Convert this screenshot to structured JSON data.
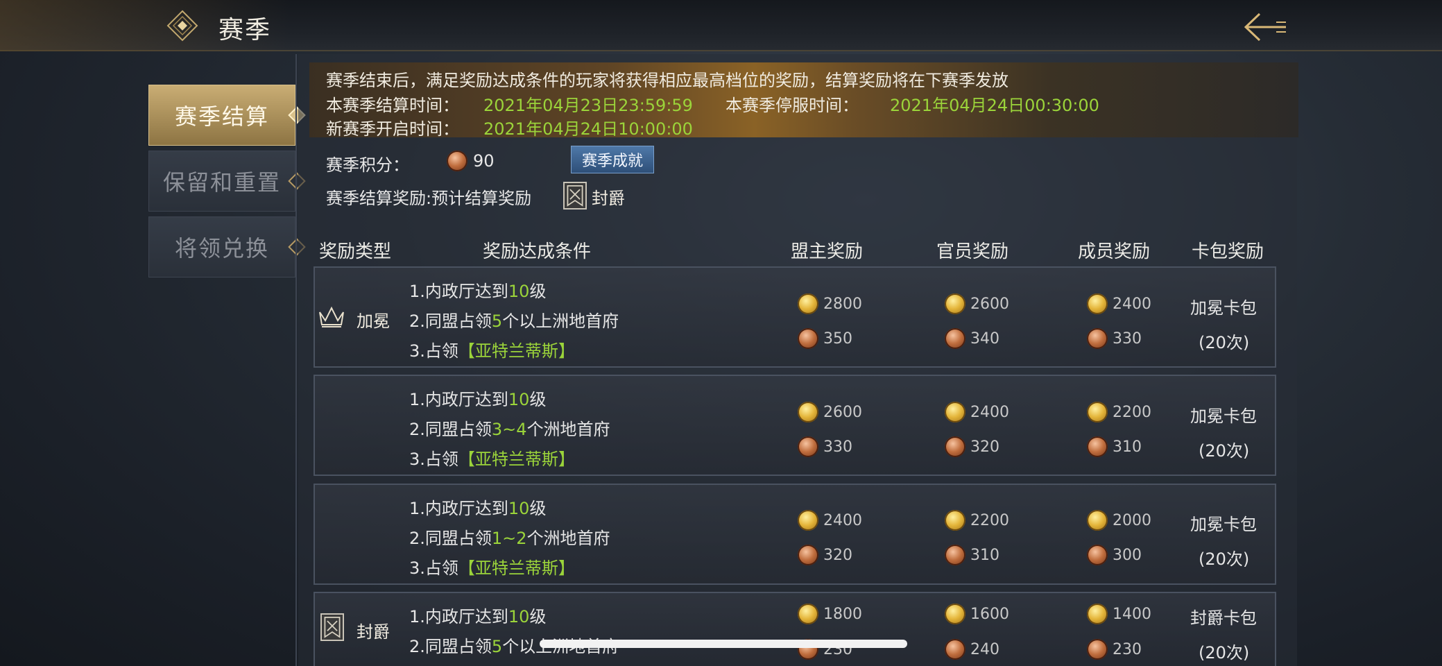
{
  "header": {
    "title": "赛季"
  },
  "sidebar": {
    "items": [
      {
        "label": "赛季结算",
        "active": true
      },
      {
        "label": "保留和重置",
        "active": false
      },
      {
        "label": "将领兑换",
        "active": false
      }
    ]
  },
  "banner": {
    "notice": "赛季结束后，满足奖励达成条件的玩家将获得相应最高档位的奖励，结算奖励将在下赛季发放",
    "settle_label": "本赛季结算时间：",
    "settle_time": "2021年04月23日23:59:59",
    "stop_label": "本赛季停服时间：",
    "stop_time": "2021年04月24日00:30:00",
    "new_label": "新赛季开启时间：",
    "new_time": "2021年04月24日10:00:00"
  },
  "score": {
    "label": "赛季积分：",
    "value": "90",
    "achievement_button": "赛季成就"
  },
  "reward": {
    "label": "赛季结算奖励:预计结算奖励",
    "rank": "封爵"
  },
  "table": {
    "headers": [
      "奖励类型",
      "奖励达成条件",
      "盟主奖励",
      "官员奖励",
      "成员奖励",
      "卡包奖励"
    ],
    "rows": [
      {
        "type": "加冕",
        "c1a": "1.内政厅达到",
        "c1b": "10",
        "c1c": "级",
        "c2a": "2.同盟占领",
        "c2b": "5",
        "c2c": "个以上洲地首府",
        "c3a": "3.占领",
        "c3b": "【亚特兰蒂斯】",
        "leader": [
          "2800",
          "350"
        ],
        "officer": [
          "2600",
          "340"
        ],
        "member": [
          "2400",
          "330"
        ],
        "pack": [
          "加冕卡包",
          "(20次)"
        ]
      },
      {
        "type": "",
        "c1a": "1.内政厅达到",
        "c1b": "10",
        "c1c": "级",
        "c2a": "2.同盟占领",
        "c2b": "3~4",
        "c2c": "个洲地首府",
        "c3a": "3.占领",
        "c3b": "【亚特兰蒂斯】",
        "leader": [
          "2600",
          "330"
        ],
        "officer": [
          "2400",
          "320"
        ],
        "member": [
          "2200",
          "310"
        ],
        "pack": [
          "加冕卡包",
          "(20次)"
        ]
      },
      {
        "type": "",
        "c1a": "1.内政厅达到",
        "c1b": "10",
        "c1c": "级",
        "c2a": "2.同盟占领",
        "c2b": "1~2",
        "c2c": "个洲地首府",
        "c3a": "3.占领",
        "c3b": "【亚特兰蒂斯】",
        "leader": [
          "2400",
          "320"
        ],
        "officer": [
          "2200",
          "310"
        ],
        "member": [
          "2000",
          "300"
        ],
        "pack": [
          "加冕卡包",
          "(20次)"
        ]
      },
      {
        "type": "封爵",
        "c1a": "1.内政厅达到",
        "c1b": "10",
        "c1c": "级",
        "c2a": "2.同盟占领",
        "c2b": "5",
        "c2c": "个以上洲地首府",
        "c3a": "",
        "c3b": "",
        "leader": [
          "1800",
          "230"
        ],
        "officer": [
          "1600",
          "240"
        ],
        "member": [
          "1400",
          "230"
        ],
        "pack": [
          "封爵卡包",
          "(20次)"
        ]
      }
    ]
  },
  "colors": {
    "accent_gold": "#c9ad74",
    "highlight_green": "#9bd43a",
    "button_blue": "#3e6594"
  },
  "icons": {
    "logo": "diamond-emblem-icon",
    "back": "back-arrow-icon",
    "crown": "crown-icon",
    "banner": "banner-flag-icon"
  }
}
